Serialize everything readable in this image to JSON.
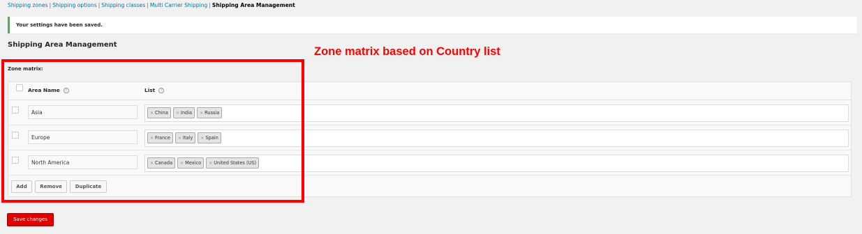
{
  "nav": {
    "items": [
      {
        "label": "Shipping zones"
      },
      {
        "label": "Shipping options"
      },
      {
        "label": "Shipping classes"
      },
      {
        "label": "Multi Carrier Shipping"
      }
    ],
    "separator": "|",
    "current": "Shipping Area Management"
  },
  "notice": {
    "text": "Your settings have been saved.",
    "color": "#46b450"
  },
  "page": {
    "title": "Shipping Area Management"
  },
  "annotation": {
    "text": "Zone matrix based on Country list",
    "color": "#ff0000"
  },
  "matrix": {
    "label": "Zone matrix:",
    "columns": {
      "area_name": "Area Name",
      "list": "List",
      "help_icon": "?"
    },
    "rows": [
      {
        "area": "Asia",
        "countries": [
          "China",
          "India",
          "Russia"
        ]
      },
      {
        "area": "Europe",
        "countries": [
          "France",
          "Italy",
          "Spain"
        ]
      },
      {
        "area": "North America",
        "countries": [
          "Canada",
          "Mexico",
          "United States (US)"
        ]
      }
    ],
    "chip_remove": "×",
    "buttons": {
      "add": "Add",
      "remove": "Remove",
      "duplicate": "Duplicate"
    }
  },
  "save_button": {
    "label": "Save changes",
    "color": "#e00000"
  }
}
